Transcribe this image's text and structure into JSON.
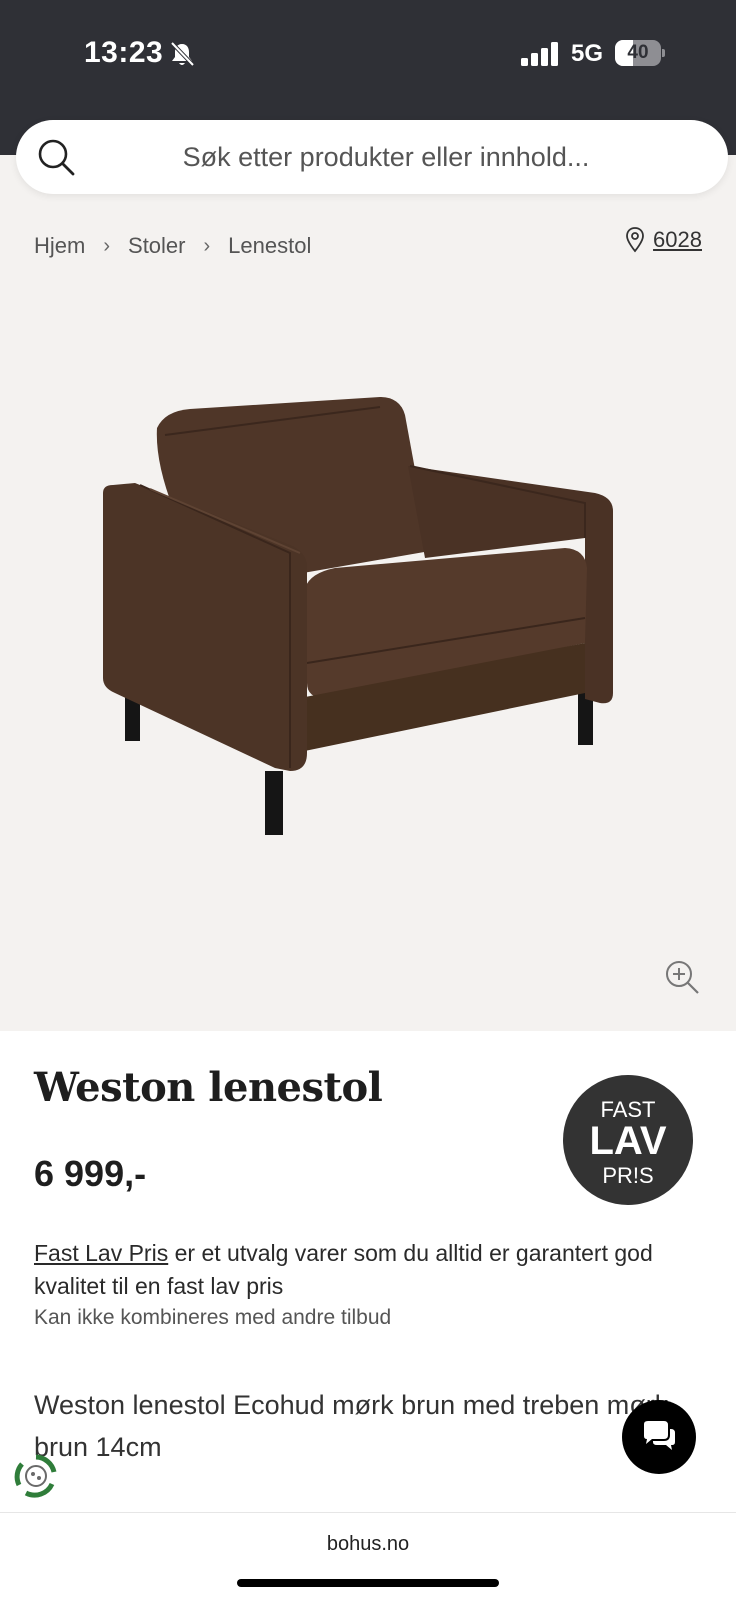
{
  "status_bar": {
    "time": "13:23",
    "network": "5G",
    "battery_level": "40",
    "battery_fraction": 0.4,
    "icons": [
      "bell-off-icon",
      "signal-icon",
      "battery-icon"
    ]
  },
  "search": {
    "placeholder": "Søk etter produkter eller innhold..."
  },
  "breadcrumb": {
    "items": [
      "Hjem",
      "Stoler",
      "Lenestol"
    ],
    "separator": "›"
  },
  "location": {
    "code": "6028",
    "icon": "location-pin-icon"
  },
  "product": {
    "title": "Weston lenestol",
    "price": "6 999,-",
    "image_icon": "zoom-in-icon",
    "description": "Weston lenestol Ecohud mørk brun med treben mørk brun 14cm"
  },
  "fast_lav_pris": {
    "badge_line1": "FAST",
    "badge_line2": "LAV",
    "badge_line3": "PR!S",
    "link_text": "Fast Lav Pris",
    "text": " er et utvalg varer som du alltid er garantert god kvalitet til en fast lav pris",
    "note": "Kan ikke kombineres med andre tilbud"
  },
  "chat": {
    "icon": "chat-bubbles-icon"
  },
  "browser": {
    "url": "bohus.no"
  },
  "colors": {
    "status_bar_bg": "#2f3036",
    "product_bg": "#f4f2f0",
    "badge_bg": "#333333",
    "chair_brown": "#4a3326"
  }
}
